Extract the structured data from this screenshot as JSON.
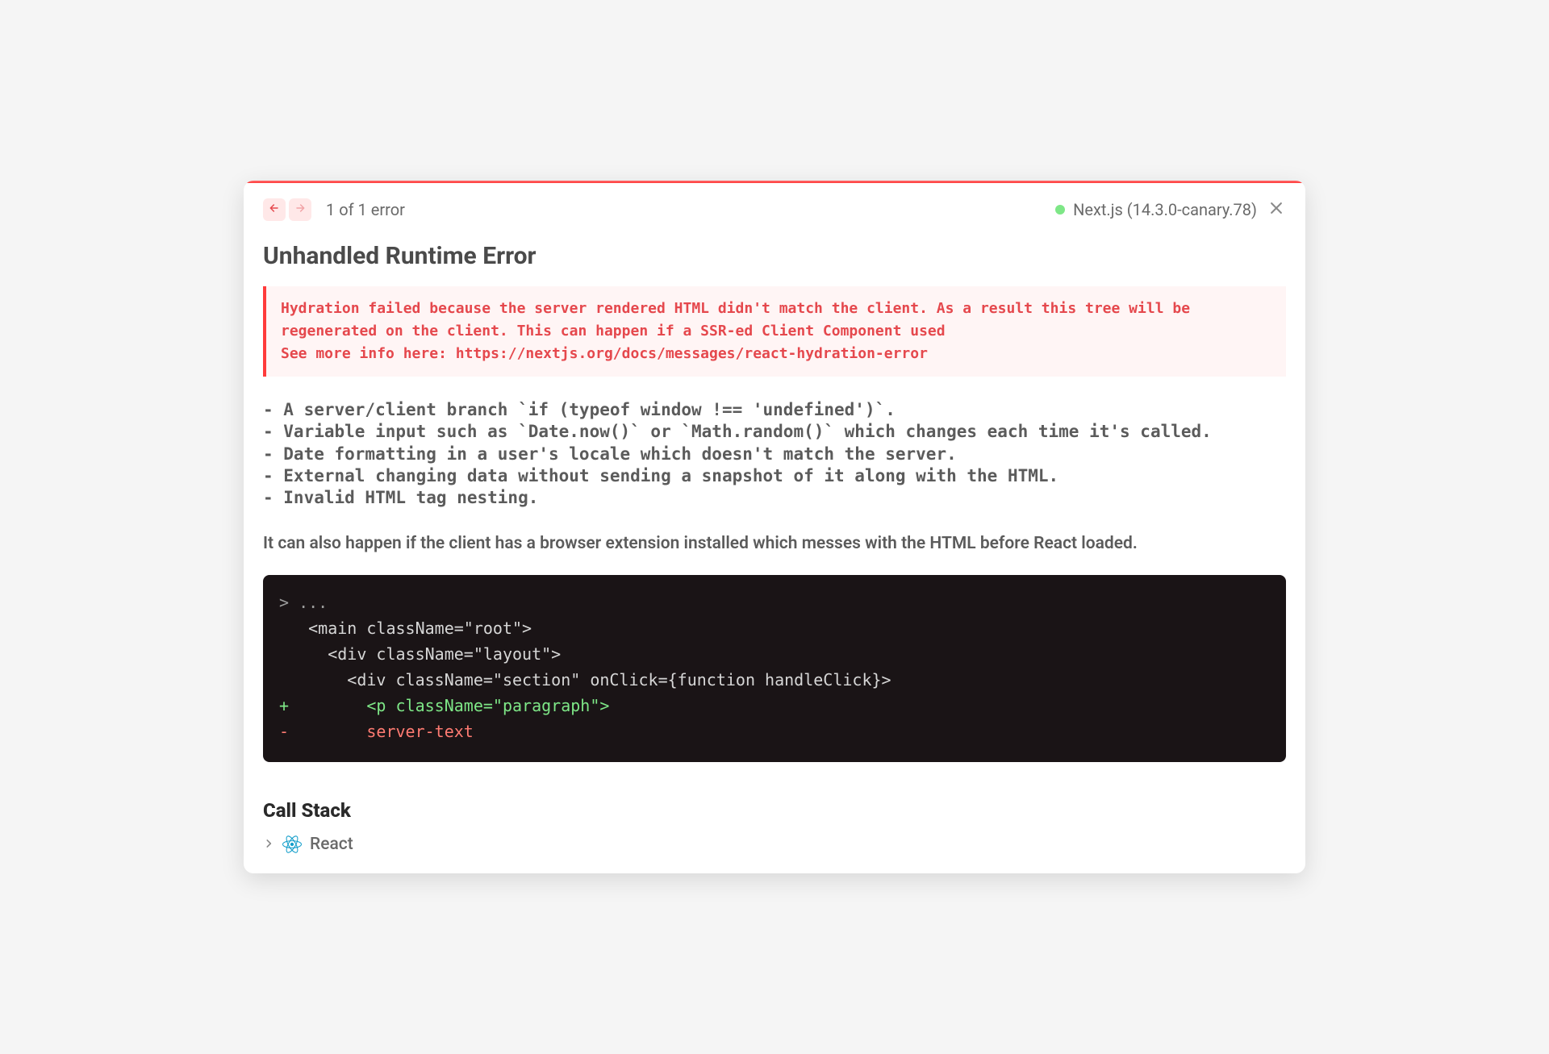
{
  "header": {
    "error_count_label": "1 of 1 error",
    "framework_label": "Next.js (14.3.0-canary.78)"
  },
  "title": "Unhandled Runtime Error",
  "error_message": {
    "line1": "Hydration failed because the server rendered HTML didn't match the client. As a result this tree will be regenerated on the client. This can happen if a SSR-ed Client Component used",
    "line2": "See more info here: https://nextjs.org/docs/messages/react-hydration-error"
  },
  "causes": [
    "- A server/client branch `if (typeof window !== 'undefined')`.",
    "- Variable input such as `Date.now()` or `Math.random()` which changes each time it's called.",
    "- Date formatting in a user's locale which doesn't match the server.",
    "- External changing data without sending a snapshot of it along with the HTML.",
    "- Invalid HTML tag nesting."
  ],
  "extra_note": "It can also happen if the client has a browser extension installed which messes with the HTML before React loaded.",
  "code": {
    "l0": "> ...",
    "l1": "   <main className=\"root\">",
    "l2": "     <div className=\"layout\">",
    "l3": "       <div className=\"section\" onClick={function handleClick}>",
    "l4": "+        <p className=\"paragraph\">",
    "l5": "-        server-text"
  },
  "stack": {
    "title": "Call Stack",
    "item_label": "React"
  }
}
